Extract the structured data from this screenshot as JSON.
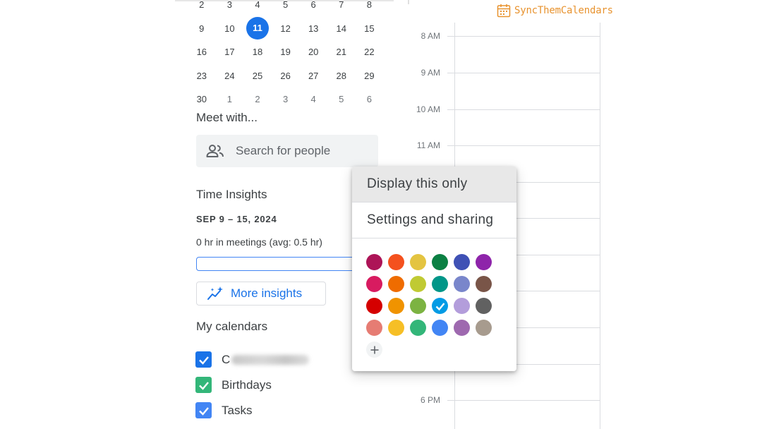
{
  "mini_calendar": {
    "weeks": [
      [
        "2",
        "3",
        "4",
        "5",
        "6",
        "7",
        "8"
      ],
      [
        "9",
        "10",
        "11",
        "12",
        "13",
        "14",
        "15"
      ],
      [
        "16",
        "17",
        "18",
        "19",
        "20",
        "21",
        "22"
      ],
      [
        "23",
        "24",
        "25",
        "26",
        "27",
        "28",
        "29"
      ],
      [
        "30",
        "1",
        "2",
        "3",
        "4",
        "5",
        "6"
      ]
    ],
    "today": "11"
  },
  "meet_with": {
    "title": "Meet with...",
    "search_placeholder": "Search for people",
    "icon": "people-icon"
  },
  "time_insights": {
    "title": "Time Insights",
    "range": "SEP 9 – 15, 2024",
    "meetings": "0 hr in meetings (avg: 0.5 hr)",
    "more_label": "More insights",
    "icon": "insights-icon"
  },
  "my_calendars": {
    "title": "My calendars",
    "items": [
      {
        "label": "C",
        "color": "#1a73e8",
        "checked": true,
        "blurred": true
      },
      {
        "label": "Birthdays",
        "color": "#33b679",
        "checked": true
      },
      {
        "label": "Tasks",
        "color": "#4285f4",
        "checked": true
      }
    ]
  },
  "day_grid": {
    "hours": [
      "8 AM",
      "9 AM",
      "10 AM",
      "11 AM",
      "6 PM"
    ]
  },
  "logo": {
    "text": "SyncThemCalendars",
    "color": "#e8932f",
    "icon": "calendar-icon"
  },
  "popup_menu": {
    "items": [
      "Display this only",
      "Settings and sharing"
    ],
    "highlighted": "Display this only",
    "colors": [
      [
        "#ad1457",
        "#f4511e",
        "#e4c441",
        "#0b8043",
        "#3f51b5",
        "#8e24aa"
      ],
      [
        "#d81b60",
        "#ef6c00",
        "#c0ca33",
        "#009688",
        "#7986cb",
        "#795548"
      ],
      [
        "#d50000",
        "#f09300",
        "#7cb342",
        "#039be5",
        "#b39ddb",
        "#616161"
      ],
      [
        "#e67c73",
        "#f6bf26",
        "#33b679",
        "#4285f4",
        "#9e69af",
        "#a79b8e"
      ]
    ],
    "selected_color": "#039be5",
    "add_color_icon": "plus-icon"
  }
}
